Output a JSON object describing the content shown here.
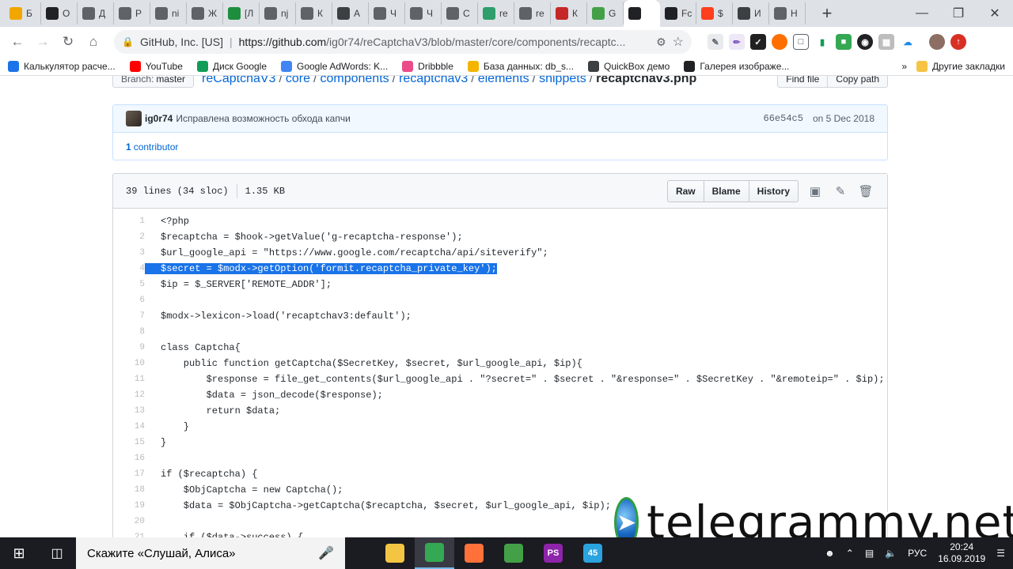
{
  "browser": {
    "tabs": [
      {
        "icon": "bank-icon",
        "label": "Б",
        "color": "#f2a600"
      },
      {
        "icon": "eye-icon",
        "label": "О",
        "color": "#202124"
      },
      {
        "icon": "globe-icon",
        "label": "Д",
        "color": "#5f6368"
      },
      {
        "icon": "globe-icon",
        "label": "Р",
        "color": "#5f6368"
      },
      {
        "icon": "globe-icon",
        "label": "ni",
        "color": "#5f6368"
      },
      {
        "icon": "globe-icon",
        "label": "Ж",
        "color": "#5f6368"
      },
      {
        "icon": "code-icon",
        "label": "[Л",
        "color": "#1e8e3e"
      },
      {
        "icon": "globe-icon",
        "label": "nj",
        "color": "#5f6368"
      },
      {
        "icon": "globe-icon",
        "label": "К",
        "color": "#5f6368"
      },
      {
        "icon": "map-icon",
        "label": "А",
        "color": "#3c4043"
      },
      {
        "icon": "globe-icon",
        "label": "Ч",
        "color": "#5f6368"
      },
      {
        "icon": "globe-icon",
        "label": "Ч",
        "color": "#5f6368"
      },
      {
        "icon": "globe-icon",
        "label": "С",
        "color": "#5f6368"
      },
      {
        "icon": "s-icon",
        "label": "re",
        "color": "#2e9e6b"
      },
      {
        "icon": "globe-icon",
        "label": "re",
        "color": "#5f6368"
      },
      {
        "icon": "up-icon",
        "label": "К",
        "color": "#c62828"
      },
      {
        "icon": "puzzle-icon",
        "label": "G",
        "color": "#43a047"
      },
      {
        "icon": "github-icon",
        "label": "",
        "color": "#202124"
      },
      {
        "icon": "tools-icon",
        "label": "Fc",
        "color": "#202124"
      },
      {
        "icon": "yandex-icon",
        "label": "$",
        "color": "#fc3f1d"
      },
      {
        "icon": "refresh-icon",
        "label": "И",
        "color": "#3c4043"
      },
      {
        "icon": "globe-icon",
        "label": "Н",
        "color": "#5f6368"
      }
    ],
    "new_tab": "+",
    "address": {
      "org": "GitHub, Inc. [US]",
      "separator": "|",
      "host": "https://github.com",
      "path": "/ig0r74/reCaptchaV3/blob/master/core/components/recaptc..."
    },
    "bookmarks": [
      {
        "icon": "calc-icon",
        "label": "Калькулятор расче...",
        "color": "#1a73e8"
      },
      {
        "icon": "youtube-icon",
        "label": "YouTube",
        "color": "#ff0000"
      },
      {
        "icon": "drive-icon",
        "label": "Диск Google",
        "color": "#0f9d58"
      },
      {
        "icon": "adwords-icon",
        "label": "Google AdWords: K...",
        "color": "#4285f4"
      },
      {
        "icon": "dribbble-icon",
        "label": "Dribbble",
        "color": "#ea4c89"
      },
      {
        "icon": "db-icon",
        "label": "База данных: db_s...",
        "color": "#f4b400"
      },
      {
        "icon": "quickbox-icon",
        "label": "QuickBox демо",
        "color": "#3c4043"
      },
      {
        "icon": "xz-icon",
        "label": "Галерея изображе...",
        "color": "#202124"
      }
    ],
    "bookmarks_more": "»",
    "other_bookmarks": "Другие закладки"
  },
  "breadcrumb": {
    "branch_label": "Branch:",
    "branch_value": "master",
    "parts": [
      "reCaptchaV3",
      "core",
      "components",
      "recaptchav3",
      "elements",
      "snippets"
    ],
    "file": "recaptchav3.php",
    "find_file": "Find file",
    "copy_path": "Copy path"
  },
  "commit": {
    "author": "ig0r74",
    "message": "Исправлена возможность обхода капчи",
    "sha": "66e54c5",
    "date": "on 5 Dec 2018",
    "contributors_count": "1",
    "contributors_label": "contributor"
  },
  "file": {
    "lines_info": "39 lines (34 sloc)",
    "size": "1.35 KB",
    "raw": "Raw",
    "blame": "Blame",
    "history": "History"
  },
  "code": [
    {
      "n": "1",
      "t": "<?php",
      "hl": false
    },
    {
      "n": "2",
      "t": "$recaptcha = $hook->getValue('g-recaptcha-response');",
      "hl": false
    },
    {
      "n": "3",
      "t": "$url_google_api = \"https://www.google.com/recaptcha/api/siteverify\";",
      "hl": false
    },
    {
      "n": "4",
      "t": "$secret = $modx->getOption('formit.recaptcha_private_key');",
      "hl": true
    },
    {
      "n": "5",
      "t": "$ip = $_SERVER['REMOTE_ADDR'];",
      "hl": false
    },
    {
      "n": "6",
      "t": "",
      "hl": false
    },
    {
      "n": "7",
      "t": "$modx->lexicon->load('recaptchav3:default');",
      "hl": false
    },
    {
      "n": "8",
      "t": "",
      "hl": false
    },
    {
      "n": "9",
      "t": "class Captcha{",
      "hl": false
    },
    {
      "n": "10",
      "t": "    public function getCaptcha($SecretKey, $secret, $url_google_api, $ip){",
      "hl": false
    },
    {
      "n": "11",
      "t": "        $response = file_get_contents($url_google_api . \"?secret=\" . $secret . \"&response=\" . $SecretKey . \"&remoteip=\" . $ip);",
      "hl": false
    },
    {
      "n": "12",
      "t": "        $data = json_decode($response);",
      "hl": false
    },
    {
      "n": "13",
      "t": "        return $data;",
      "hl": false
    },
    {
      "n": "14",
      "t": "    }",
      "hl": false
    },
    {
      "n": "15",
      "t": "}",
      "hl": false
    },
    {
      "n": "16",
      "t": "",
      "hl": false
    },
    {
      "n": "17",
      "t": "if ($recaptcha) {",
      "hl": false
    },
    {
      "n": "18",
      "t": "    $ObjCaptcha = new Captcha();",
      "hl": false
    },
    {
      "n": "19",
      "t": "    $data = $ObjCaptcha->getCaptcha($recaptcha, $secret, $url_google_api, $ip);",
      "hl": false
    },
    {
      "n": "20",
      "t": "",
      "hl": false
    },
    {
      "n": "21",
      "t": "    if ($data->success) {",
      "hl": false
    }
  ],
  "watermark": {
    "text": "telegrammy.net"
  },
  "taskbar": {
    "search_placeholder": "Скажите «Слушай, Алиса»",
    "apps": [
      {
        "icon": "explorer-icon",
        "label": "",
        "color": "#f4c542",
        "active": false
      },
      {
        "icon": "chrome-icon",
        "label": "",
        "color": "#34a853",
        "active": true
      },
      {
        "icon": "firefox-icon",
        "label": "",
        "color": "#ff7139",
        "active": false
      },
      {
        "icon": "image-icon",
        "label": "",
        "color": "#43a047",
        "active": false
      },
      {
        "icon": "phpstorm-icon",
        "label": "PS",
        "color": "#8e24aa",
        "active": false
      },
      {
        "icon": "telegram-icon",
        "label": "45",
        "color": "#2aa3df",
        "active": false
      }
    ],
    "lang": "РУС",
    "time": "20:24",
    "date": "16.09.2019"
  }
}
